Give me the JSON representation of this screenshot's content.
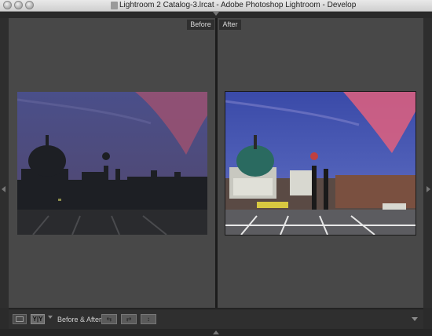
{
  "window": {
    "title": "Lightroom 2 Catalog-3.lrcat - Adobe Photoshop Lightroom - Develop"
  },
  "views": {
    "before_label": "Before",
    "after_label": "After"
  },
  "toolbar": {
    "mode_yy_label": "Y|Y",
    "before_after_label": "Before & After :",
    "swap_settings_glyph": "⇆",
    "copy_settings_glyph": "⇄",
    "swap_views_glyph": "↕"
  },
  "icons": {
    "loupe": "loupe-view-icon",
    "before_after": "before-after-icon",
    "dropdown": "chevron-down-icon"
  },
  "colors": {
    "panel_bg": "#484848",
    "toolbar_bg": "#2f2f2f",
    "divider": "#1c1c1c"
  }
}
